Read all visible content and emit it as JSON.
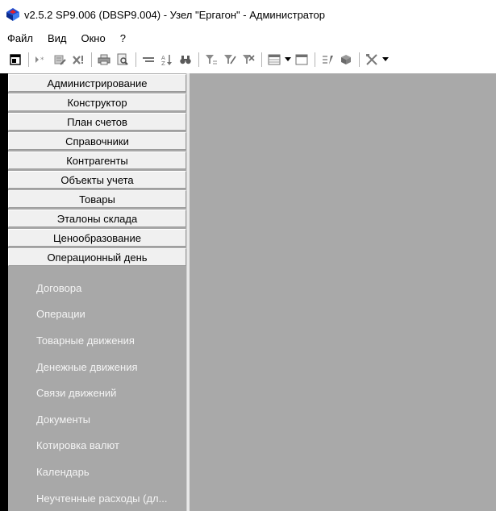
{
  "window": {
    "title": "v2.5.2 SP9.006 (DBSP9.004) - Узел \"Ергагон\" - Администратор"
  },
  "menubar": {
    "items": [
      "Файл",
      "Вид",
      "Окно",
      "?"
    ]
  },
  "toolbar": {
    "icons": [
      "show-panel-icon",
      "new-record-icon",
      "edit-record-icon",
      "delete-record-icon",
      "print-icon",
      "preview-icon",
      "collapse-icon",
      "sort-icon",
      "find-icon",
      "filter-icon",
      "filter-edit-icon",
      "filter-clear-icon",
      "grid-view-icon",
      "window-icon",
      "execute-icon",
      "cube-icon",
      "tools-icon"
    ]
  },
  "sidebar": {
    "sections": [
      "Администрирование",
      "Конструктор",
      "План счетов",
      "Справочники",
      "Контрагенты",
      "Объекты учета",
      "Товары",
      "Эталоны склада",
      "Ценообразование",
      "Операционный день"
    ],
    "items": [
      "Договора",
      "Операции",
      "Товарные движения",
      "Денежные движения",
      "Связи движений",
      "Документы",
      "Котировка валют",
      "Календарь",
      "Неучтенные расходы (дл..."
    ]
  },
  "colors": {
    "sidebar_bg": "#a8a8a8",
    "workspace_bg": "#a9a9a9",
    "button_face": "#f0f0f0",
    "item_text": "#f4f4f4"
  }
}
